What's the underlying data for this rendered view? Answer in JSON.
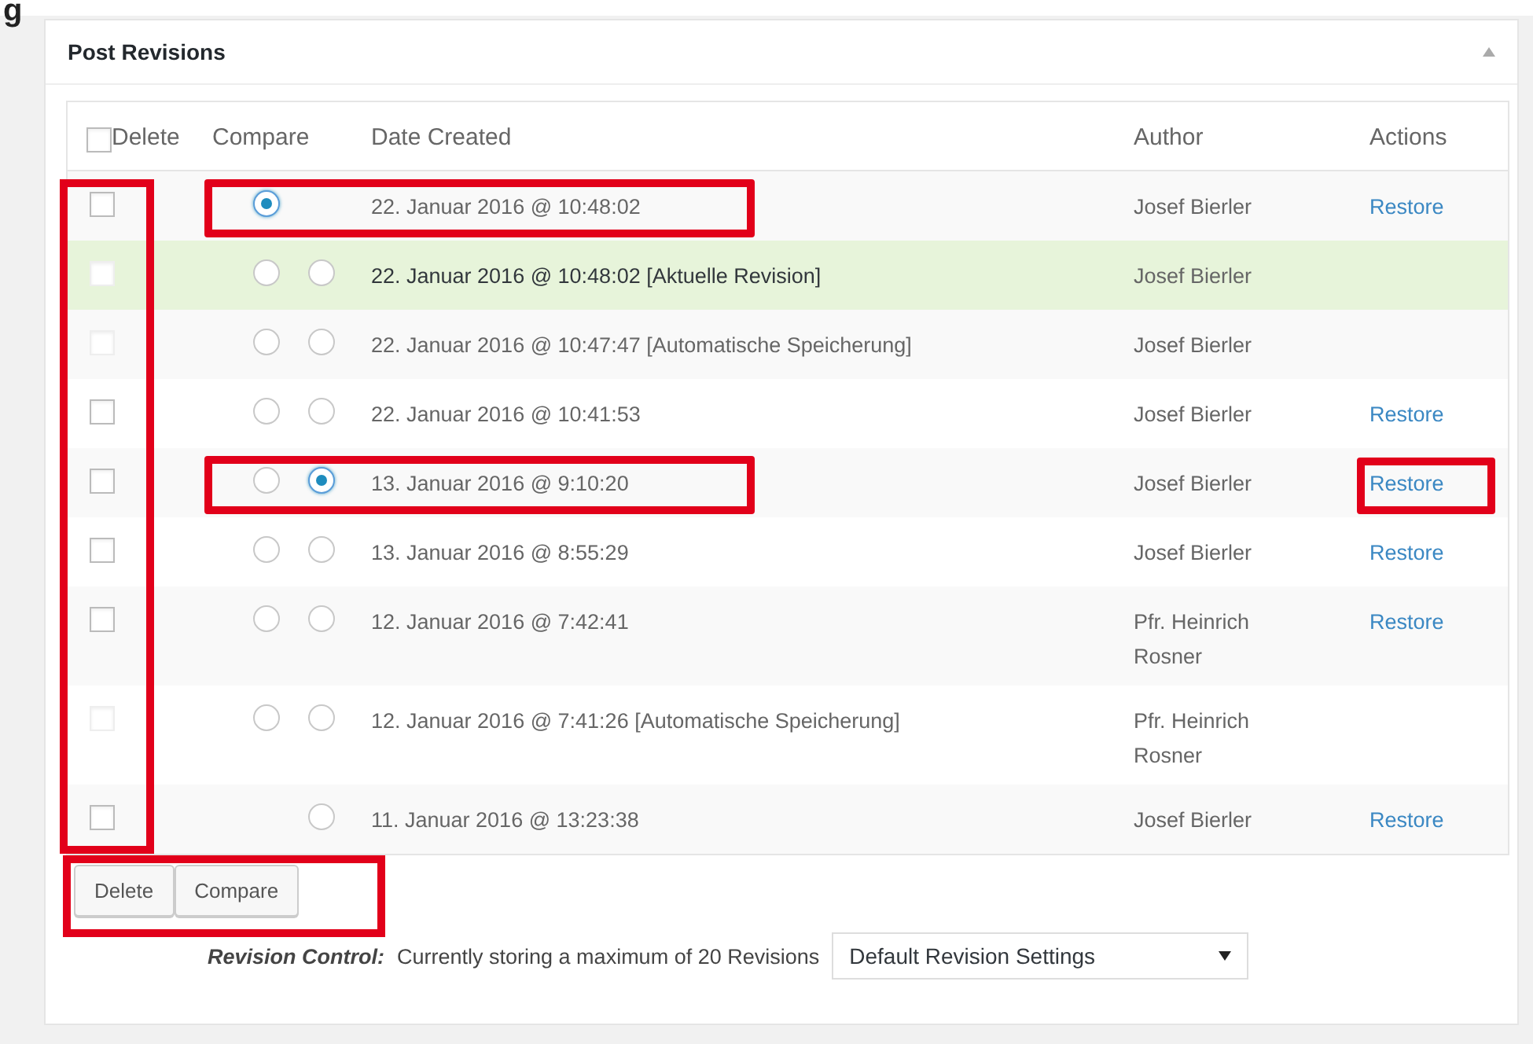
{
  "page_heading": "g",
  "panel": {
    "title": "Post Revisions"
  },
  "table": {
    "select_all": {
      "checked": false
    },
    "columns": [
      "Delete",
      "Compare",
      "Date Created",
      "Author",
      "Actions"
    ],
    "delete_column_highlighted": true,
    "rows": [
      {
        "checkbox": {
          "checked": false,
          "disabled": false
        },
        "from_radio": {
          "selected": true
        },
        "date": "22. Januar 2016 @ 10:48:02",
        "author": "Josef Bierler",
        "action": "Restore",
        "current": false,
        "compare_highlighted": true,
        "action_highlighted": false
      },
      {
        "checkbox": {
          "checked": false,
          "disabled": true
        },
        "from_radio": {
          "selected": false
        },
        "to_radio": {
          "selected": false
        },
        "date": "22. Januar 2016 @ 10:48:02 [Aktuelle Revision]",
        "author": "Josef Bierler",
        "current": true,
        "compare_highlighted": false,
        "action_highlighted": false
      },
      {
        "checkbox": {
          "checked": false,
          "disabled": true
        },
        "from_radio": {
          "selected": false
        },
        "to_radio": {
          "selected": false
        },
        "date": "22. Januar 2016 @ 10:47:47 [Automatische Speicherung]",
        "author": "Josef Bierler",
        "current": false,
        "compare_highlighted": false,
        "action_highlighted": false
      },
      {
        "checkbox": {
          "checked": false,
          "disabled": false
        },
        "from_radio": {
          "selected": false
        },
        "to_radio": {
          "selected": false
        },
        "date": "22. Januar 2016 @ 10:41:53",
        "author": "Josef Bierler",
        "action": "Restore",
        "current": false,
        "compare_highlighted": false,
        "action_highlighted": false
      },
      {
        "checkbox": {
          "checked": false,
          "disabled": false
        },
        "from_radio": {
          "selected": false
        },
        "to_radio": {
          "selected": true
        },
        "date": "13. Januar 2016 @ 9:10:20",
        "author": "Josef Bierler",
        "action": "Restore",
        "current": false,
        "compare_highlighted": true,
        "action_highlighted": true
      },
      {
        "checkbox": {
          "checked": false,
          "disabled": false
        },
        "from_radio": {
          "selected": false
        },
        "to_radio": {
          "selected": false
        },
        "date": "13. Januar 2016 @ 8:55:29",
        "author": "Josef Bierler",
        "action": "Restore",
        "current": false,
        "compare_highlighted": false,
        "action_highlighted": false
      },
      {
        "checkbox": {
          "checked": false,
          "disabled": false
        },
        "from_radio": {
          "selected": false
        },
        "to_radio": {
          "selected": false
        },
        "date": "12. Januar 2016 @ 7:42:41",
        "author": "Pfr. Heinrich Rosner",
        "action": "Restore",
        "current": false,
        "compare_highlighted": false,
        "action_highlighted": false
      },
      {
        "checkbox": {
          "checked": false,
          "disabled": true
        },
        "from_radio": {
          "selected": false
        },
        "to_radio": {
          "selected": false
        },
        "date": "12. Januar 2016 @ 7:41:26 [Automatische Speicherung]",
        "author": "Pfr. Heinrich Rosner",
        "current": false,
        "compare_highlighted": false,
        "action_highlighted": false
      },
      {
        "checkbox": {
          "checked": false,
          "disabled": false
        },
        "to_radio": {
          "selected": false
        },
        "date": "11. Januar 2016 @ 13:23:38",
        "author": "Josef Bierler",
        "action": "Restore",
        "current": false,
        "compare_highlighted": false,
        "action_highlighted": false
      }
    ]
  },
  "buttons": [
    "Delete",
    "Compare"
  ],
  "buttons_highlighted": true,
  "footer": {
    "label": "Revision Control:",
    "text": "Currently storing a maximum of 20 Revisions",
    "select": {
      "value": "Default Revision Settings"
    }
  }
}
